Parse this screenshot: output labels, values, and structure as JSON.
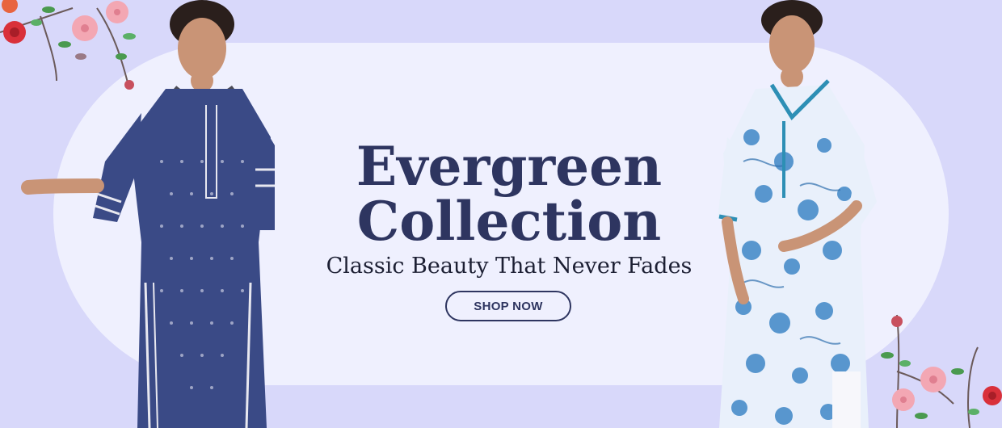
{
  "banner": {
    "headline_line1": "Evergreen",
    "headline_line2": "Collection",
    "tagline": "Classic Beauty That Never Fades",
    "cta_label": "SHOP NOW"
  },
  "colors": {
    "background": "#d8d8fa",
    "pill": "#eff0fe",
    "heading": "#2e3560",
    "kurta_left": "#3a4a86",
    "kurta_right_print": "#3f87c7"
  },
  "decor": {
    "left_model": "model-navy-kurta",
    "right_model": "model-floral-kurta",
    "flowers": "floral-branch"
  }
}
